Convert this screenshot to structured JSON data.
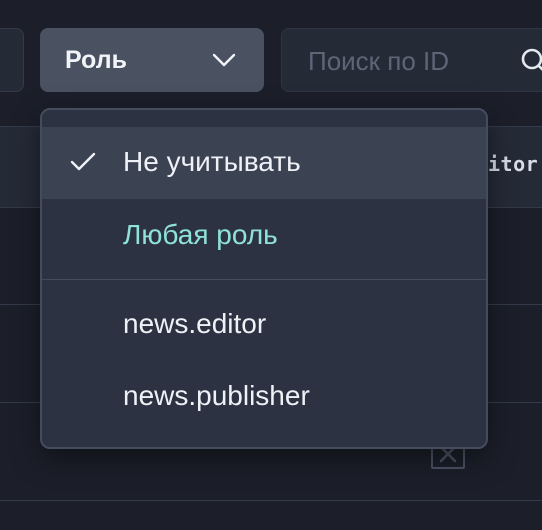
{
  "toolbar": {
    "role_filter": {
      "label": "Роль"
    },
    "search": {
      "placeholder": "Поиск по ID",
      "value": ""
    }
  },
  "table": {
    "header_partial_text": "itor"
  },
  "role_dropdown": {
    "items": [
      {
        "label": "Не учитывать",
        "selected": true
      },
      {
        "label": "Любая роль",
        "selected": false
      },
      {
        "label": "news.editor",
        "selected": false
      },
      {
        "label": "news.publisher",
        "selected": false
      }
    ]
  },
  "colors": {
    "background": "#1c1f2a",
    "dropdown_background": "#2c3242",
    "selected_item": "#3b4252",
    "accent_teal": "#8fe3d6",
    "select_button": "#4a5161"
  },
  "icons": {
    "role_select": "chevron-down-icon",
    "search": "search-icon",
    "selected_item": "check-icon",
    "row_action": "close-box-icon"
  }
}
